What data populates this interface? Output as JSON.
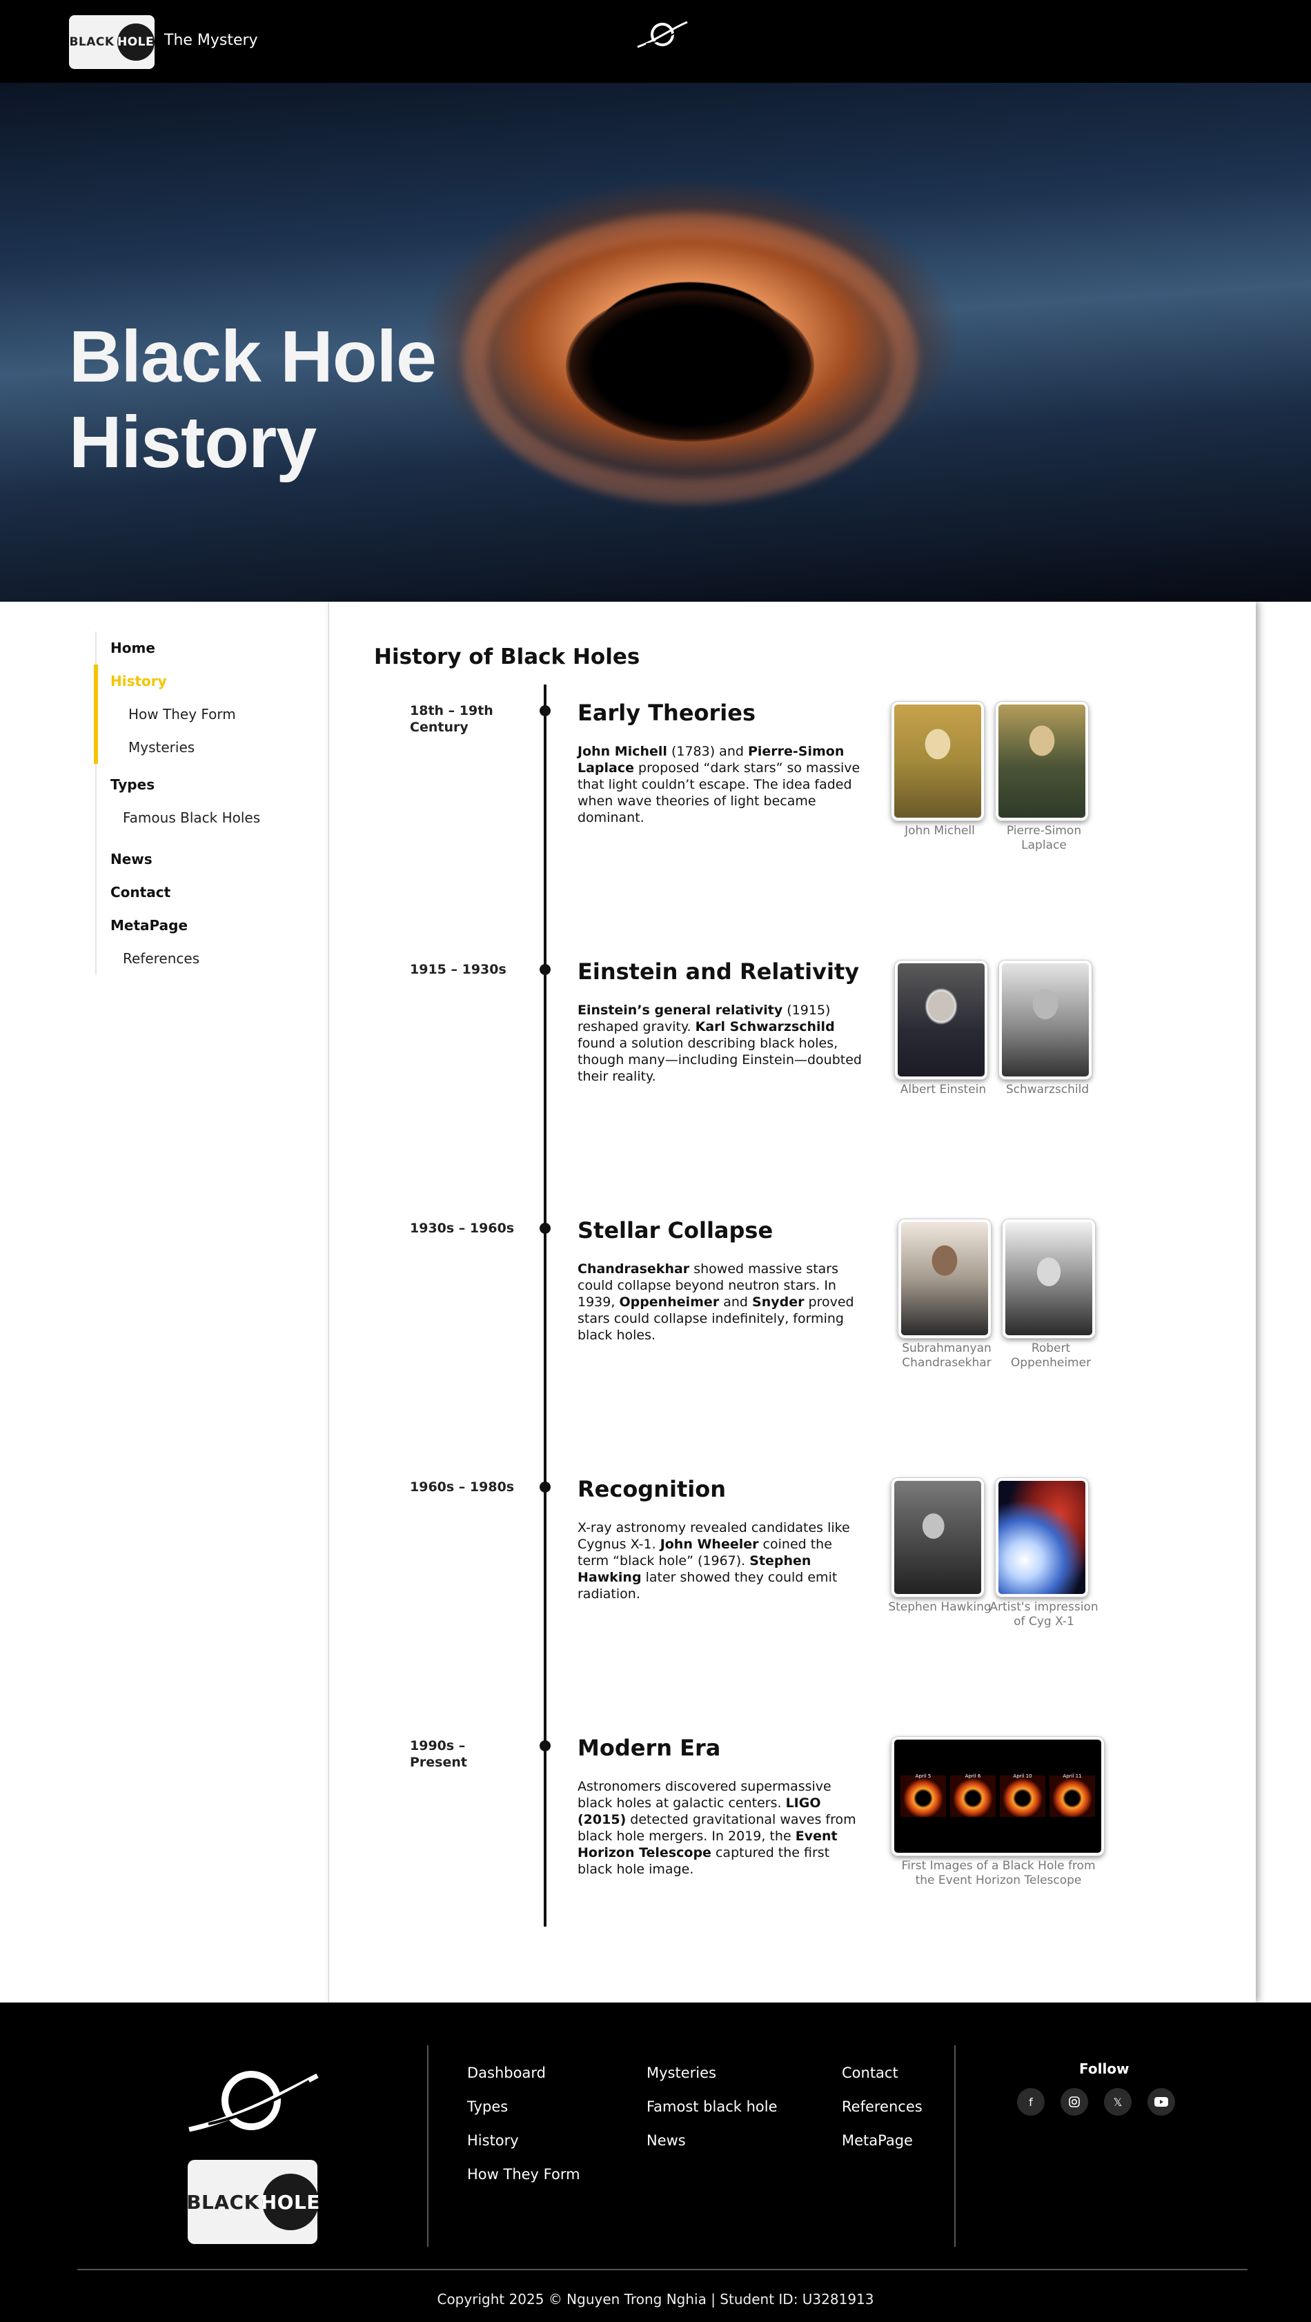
{
  "header": {
    "logo_left": "BLACK",
    "logo_right": "HOLE",
    "site_name": "The Mystery"
  },
  "hero": {
    "title_line1": "Black Hole",
    "title_line2": "History"
  },
  "sidebar": {
    "items": [
      {
        "label": "Home"
      },
      {
        "label": "History"
      },
      {
        "label": "How They Form"
      },
      {
        "label": "Mysteries"
      },
      {
        "label": "Types"
      },
      {
        "label": "Famous Black Holes"
      },
      {
        "label": "News"
      },
      {
        "label": "Contact"
      },
      {
        "label": "MetaPage"
      },
      {
        "label": "References"
      }
    ],
    "active_color": "#f5c400"
  },
  "main": {
    "title": "History of Black Holes",
    "entries": [
      {
        "date": "18th – 19th Century",
        "heading": "Early Theories",
        "captions": [
          "John Michell",
          "Pierre-Simon Laplace"
        ]
      },
      {
        "date": "1915 – 1930s",
        "heading": "Einstein and Relativity",
        "captions": [
          "Albert Einstein",
          "Schwarzschild"
        ]
      },
      {
        "date": "1930s – 1960s",
        "heading": "Stellar Collapse",
        "captions": [
          "Subrahmanyan Chandrasekhar",
          "Robert Oppenheimer"
        ]
      },
      {
        "date": "1960s – 1980s",
        "heading": "Recognition",
        "captions": [
          "Stephen Hawking",
          "Artist's impression of Cyg X-1"
        ]
      },
      {
        "date": "1990s – Present",
        "heading": "Modern Era",
        "captions": [
          "First Images of a Black Hole from the Event Horizon Telescope"
        ],
        "eht_labels": [
          "April 5",
          "April 6",
          "April 10",
          "April 11"
        ]
      }
    ],
    "texts": {
      "e1": {
        "b1": "John Michell",
        "t1": " (1783) and ",
        "b2": "Pierre-Simon Laplace",
        "t2": " proposed “dark stars” so massive that light couldn’t escape. The idea faded when wave theories of light became dominant."
      },
      "e2": {
        "b1": "Einstein’s general relativity",
        "t1": " (1915) reshaped gravity. ",
        "b2": "Karl Schwarzschild",
        "t2": " found a solution describing black holes, though many—including Einstein—doubted their reality."
      },
      "e3": {
        "b1": "Chandrasekhar",
        "t1": " showed massive stars could collapse beyond neutron stars. In 1939, ",
        "b2": "Oppenheimer",
        "t2": " and ",
        "b3": "Snyder",
        "t3": " proved stars could collapse indefinitely, forming black holes."
      },
      "e4": {
        "t0": "X-ray astronomy revealed candidates like Cygnus X-1. ",
        "b1": "John Wheeler",
        "t1": " coined the term “black hole” (1967). ",
        "b2": "Stephen Hawking",
        "t2": " later showed they could emit radiation."
      },
      "e5": {
        "t0": "Astronomers discovered supermassive black holes at galactic centers. ",
        "b1": "LIGO (2015)",
        "t1": " detected gravitational waves from black hole mergers. In 2019, the ",
        "b2": "Event Horizon Telescope",
        "t2": " captured the first black hole image."
      }
    }
  },
  "footer": {
    "logo_left": "BLACK",
    "logo_right": "HOLE",
    "col1": [
      "Dashboard",
      "Types",
      "History",
      "How They Form"
    ],
    "col2": [
      "Mysteries",
      "Famost black hole",
      "News"
    ],
    "col3": [
      "Contact",
      "References",
      "MetaPage"
    ],
    "follow": "Follow",
    "social_icons": [
      "facebook-icon",
      "instagram-icon",
      "x-icon",
      "youtube-icon"
    ],
    "copyright": "Copyright 2025 © Nguyen Trong Nghia | Student ID: U3281913"
  }
}
